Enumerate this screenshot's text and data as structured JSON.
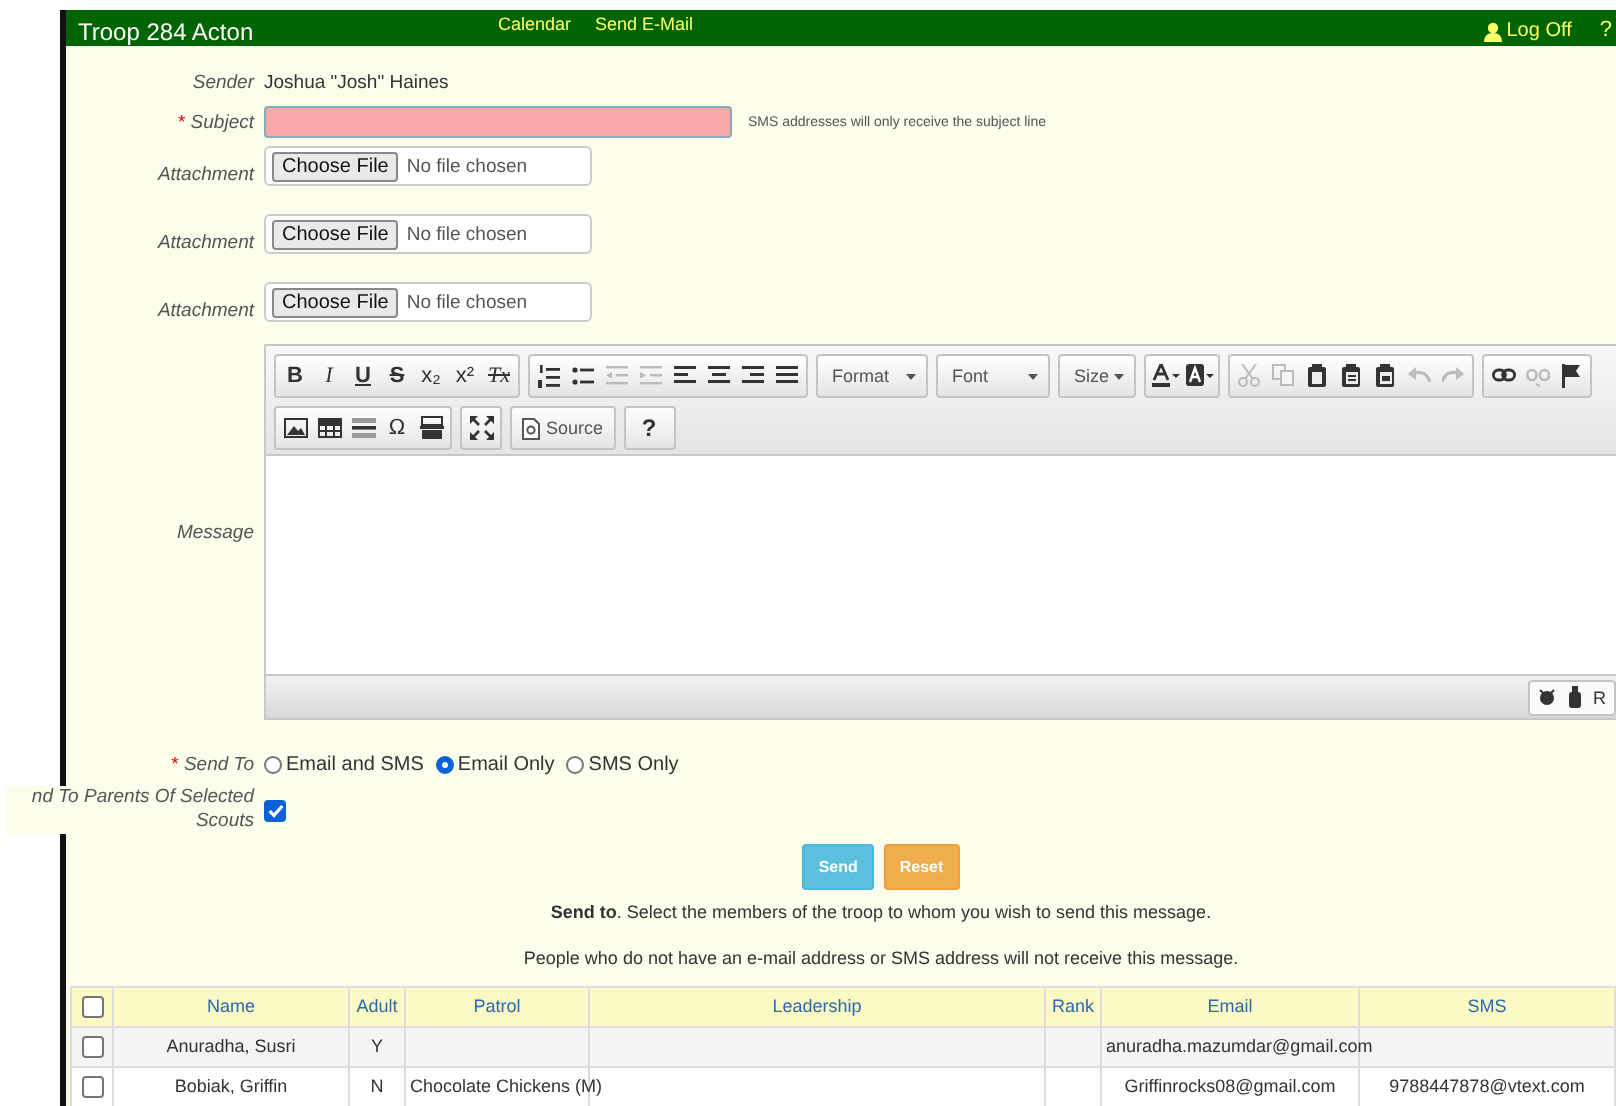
{
  "header": {
    "title": "Troop 284 Acton",
    "nav": [
      {
        "label": "Calendar"
      },
      {
        "label": "Send E-Mail"
      }
    ],
    "logoff": "Log Off",
    "help": "?"
  },
  "form": {
    "sender": {
      "label": "Sender",
      "value": "Joshua \"Josh\" Haines"
    },
    "subject": {
      "label": "Subject",
      "required_mark": "*",
      "note": "SMS addresses will only receive the subject line"
    },
    "attachments": [
      {
        "label": "Attachment",
        "button": "Choose File",
        "status": "No file chosen"
      },
      {
        "label": "Attachment",
        "button": "Choose File",
        "status": "No file chosen"
      },
      {
        "label": "Attachment",
        "button": "Choose File",
        "status": "No file chosen"
      }
    ],
    "message_label": "Message",
    "send_to": {
      "label": "Send To",
      "required_mark": "*",
      "options": [
        {
          "label": "Email and SMS",
          "selected": false
        },
        {
          "label": "Email Only",
          "selected": true
        },
        {
          "label": "SMS Only",
          "selected": false
        }
      ]
    },
    "parents": {
      "label": "nd To Parents Of Selected Scouts",
      "checked": true
    },
    "buttons": [
      {
        "label": "Send",
        "kind": "primary"
      },
      {
        "label": "Reset",
        "kind": "warning"
      }
    ],
    "info": [
      "**Send to**. Select the members of the troop to whom you wish to send this message.",
      "People who do not have an e-mail address or SMS address will not receive this message."
    ]
  },
  "editor": {
    "toolbar": [
      [
        [
          {
            "kind": "glyph",
            "label": "B"
          },
          {
            "kind": "glyph",
            "label": "I"
          },
          {
            "kind": "glyph",
            "label": "U"
          },
          {
            "kind": "glyph",
            "label": "S"
          },
          {
            "kind": "glyph",
            "label": "x₂"
          },
          {
            "kind": "glyph",
            "label": "x²"
          },
          {
            "kind": "glyph",
            "label": "Tx"
          }
        ],
        [
          {
            "kind": "icon",
            "disabled": false
          },
          {
            "kind": "icon",
            "disabled": false
          },
          {
            "kind": "icon",
            "disabled": true
          },
          {
            "kind": "icon",
            "disabled": true
          },
          {
            "kind": "icon",
            "disabled": false
          },
          {
            "kind": "icon",
            "disabled": false
          },
          {
            "kind": "icon",
            "disabled": false
          },
          {
            "kind": "icon",
            "disabled": false
          }
        ],
        [
          {
            "kind": "combo",
            "label": "Format"
          }
        ],
        [
          {
            "kind": "combo",
            "label": "Font"
          }
        ],
        [
          {
            "kind": "combo",
            "label": "Size"
          }
        ],
        [
          {
            "kind": "icon",
            "disabled": false
          },
          {
            "kind": "icon",
            "disabled": false
          }
        ],
        [
          {
            "kind": "icon",
            "disabled": true
          },
          {
            "kind": "icon",
            "disabled": true
          },
          {
            "kind": "icon",
            "disabled": false
          },
          {
            "kind": "icon",
            "disabled": false
          },
          {
            "kind": "icon",
            "disabled": false
          },
          {
            "kind": "icon",
            "disabled": true
          },
          {
            "kind": "icon",
            "disabled": true
          }
        ],
        [
          {
            "kind": "icon",
            "disabled": false
          },
          {
            "kind": "icon",
            "disabled": true
          },
          {
            "kind": "icon",
            "disabled": false
          }
        ]
      ],
      [
        [
          {
            "kind": "icon",
            "disabled": false
          },
          {
            "kind": "icon",
            "disabled": false
          },
          {
            "kind": "icon",
            "disabled": false
          },
          {
            "kind": "glyph",
            "label": "Ω"
          },
          {
            "kind": "icon",
            "disabled": false
          }
        ],
        [
          {
            "kind": "icon",
            "disabled": false
          }
        ],
        [
          {
            "kind": "source",
            "label": "Source"
          }
        ],
        [
          {
            "kind": "glyph",
            "label": "?"
          }
        ]
      ]
    ],
    "status_right": "R"
  },
  "table": {
    "all_checked": false,
    "columns": [
      "Name",
      "Adult",
      "Patrol",
      "Leadership",
      "Rank",
      "Email",
      "SMS"
    ],
    "rows": [
      {
        "checked": false,
        "cells": [
          "Anuradha, Susri",
          "Y",
          "",
          "",
          "",
          "anuradha.mazumdar@gmail.com",
          ""
        ]
      },
      {
        "checked": false,
        "cells": [
          "Bobiak, Griffin",
          "N",
          "Chocolate Chickens (M)",
          "",
          "",
          "Griffinrocks08@gmail.com",
          "9788447878@vtext.com"
        ]
      }
    ]
  }
}
